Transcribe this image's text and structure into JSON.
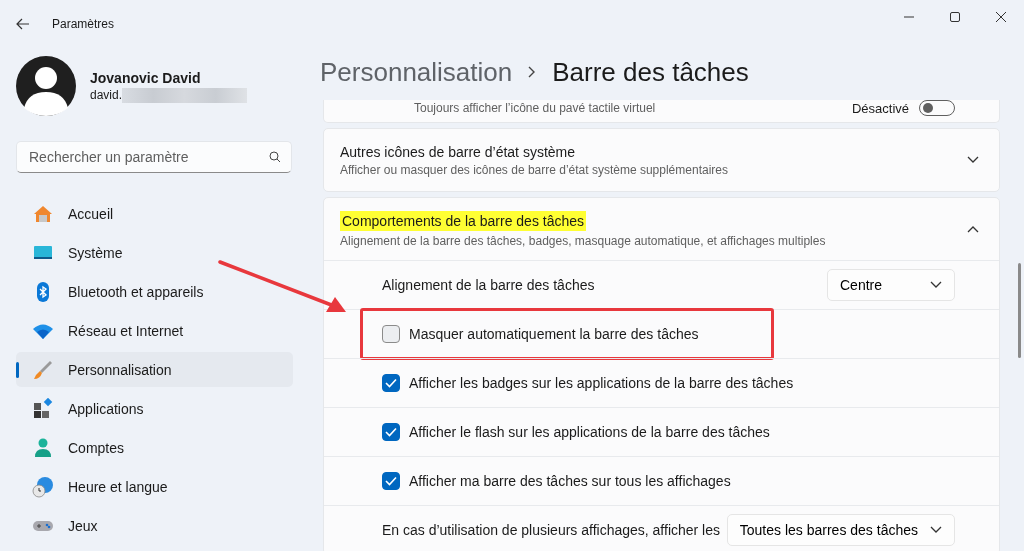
{
  "window": {
    "title": "Paramètres"
  },
  "account": {
    "name": "Jovanovic David",
    "email": "david.",
    "email_redacted": true
  },
  "search": {
    "placeholder": "Rechercher un paramètre"
  },
  "nav": [
    {
      "label": "Accueil",
      "kind": "home",
      "selected": false
    },
    {
      "label": "Système",
      "kind": "system",
      "selected": false
    },
    {
      "label": "Bluetooth et appareils",
      "kind": "bluetooth",
      "selected": false
    },
    {
      "label": "Réseau et Internet",
      "kind": "wifi",
      "selected": false
    },
    {
      "label": "Personnalisation",
      "kind": "brush",
      "selected": true
    },
    {
      "label": "Applications",
      "kind": "apps",
      "selected": false
    },
    {
      "label": "Comptes",
      "kind": "person",
      "selected": false
    },
    {
      "label": "Heure et langue",
      "kind": "clock",
      "selected": false
    },
    {
      "label": "Jeux",
      "kind": "gamepad",
      "selected": false
    }
  ],
  "breadcrumb": {
    "parent": "Personnalisation",
    "current": "Barre des tâches"
  },
  "cards": [
    {
      "kind": "toggle",
      "description": "Toujours afficher l’icône du pavé tactile virtuel",
      "state_label": "Désactivé",
      "on": false
    },
    {
      "kind": "expander",
      "title": "Autres icônes de barre d’état système",
      "description": "Afficher ou masquer des icônes de barre d’état système supplémentaires",
      "highlighted": false,
      "expanded": false
    },
    {
      "kind": "expander",
      "title": "Comportements de la barre des tâches",
      "description": "Alignement de la barre des tâches, badges, masquage automatique, et affichages multiples",
      "highlighted": true,
      "expanded": true,
      "rows": [
        {
          "kind": "dropdown",
          "label": "Alignement de la barre des tâches",
          "value": "Centre"
        },
        {
          "kind": "checkbox",
          "label": "Masquer automatiquement la barre des tâches",
          "checked": false,
          "framed": true
        },
        {
          "kind": "checkbox",
          "label": "Afficher les badges sur les applications de la barre des tâches",
          "checked": true,
          "framed": false
        },
        {
          "kind": "checkbox",
          "label": "Afficher le flash sur les applications de la barre des tâches",
          "checked": true,
          "framed": false
        },
        {
          "kind": "checkbox",
          "label": "Afficher ma barre des tâches sur tous les affichages",
          "checked": true,
          "framed": false
        },
        {
          "kind": "dropdown",
          "label": "En cas d’utilisation de plusieurs affichages, afficher les",
          "value": "Toutes les barres des tâches"
        }
      ]
    }
  ],
  "annotation": {
    "arrow": true
  }
}
